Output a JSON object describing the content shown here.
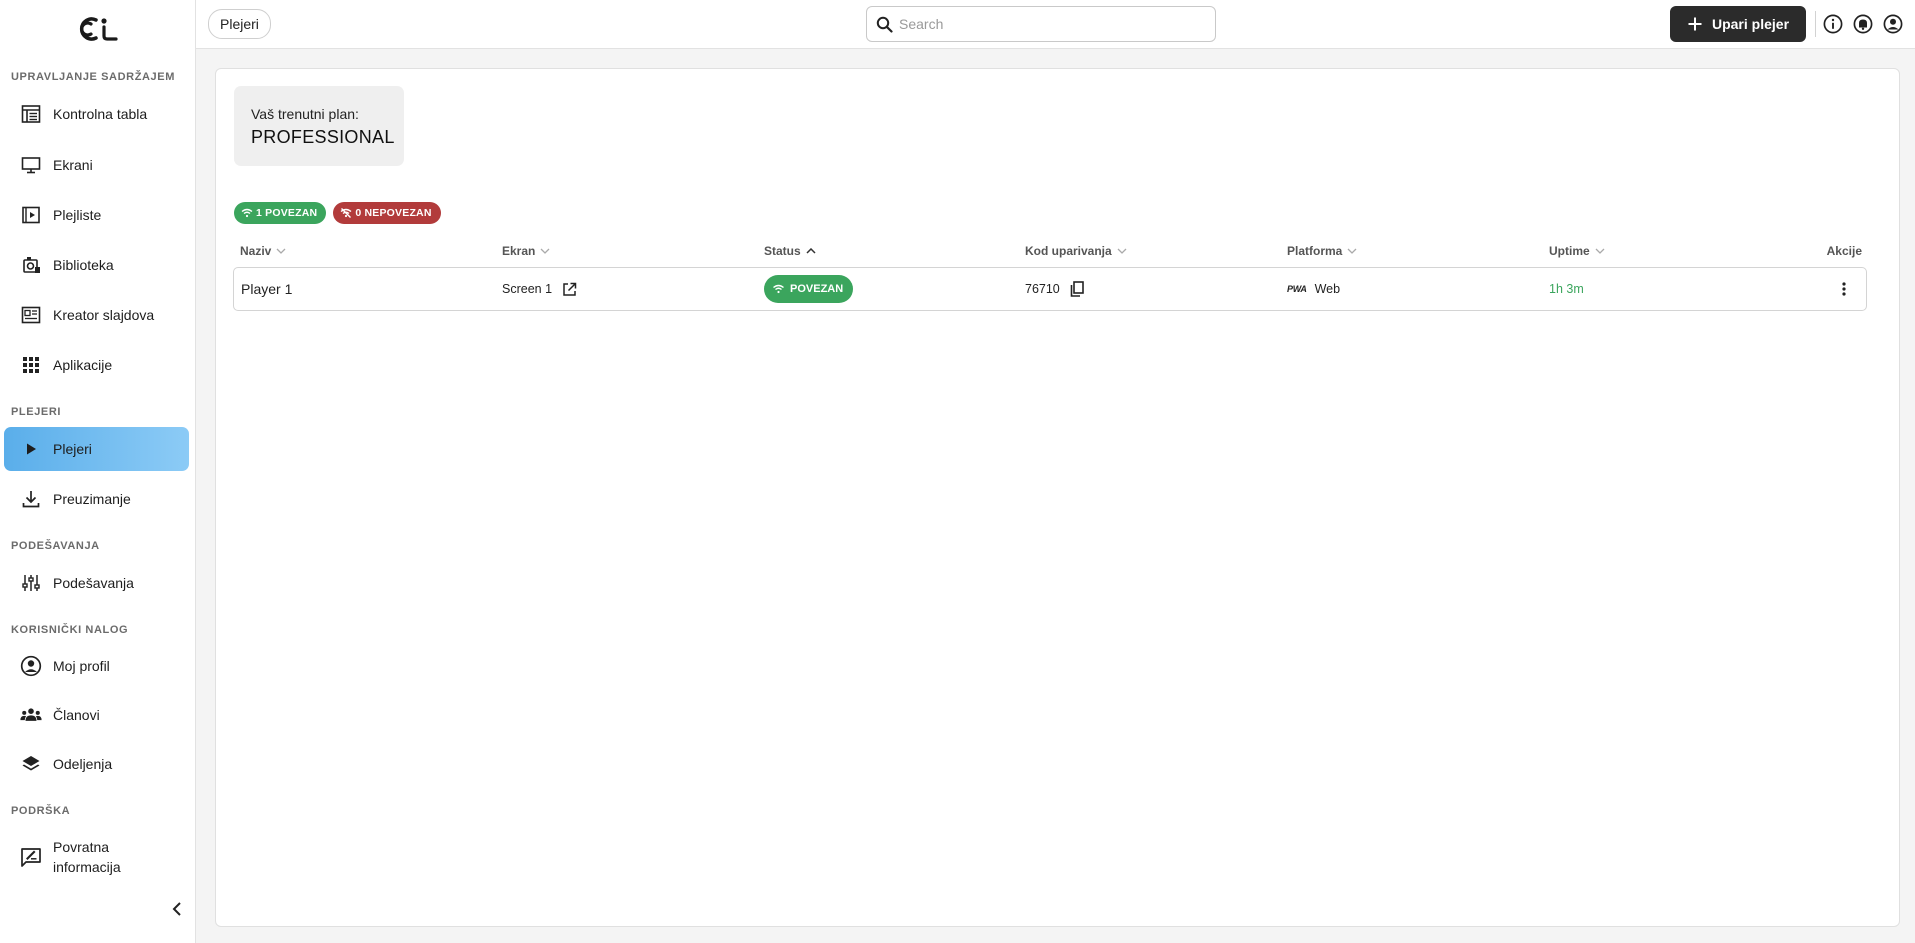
{
  "sidebar": {
    "sections": [
      {
        "title": "UPRAVLJANJE SADRŽAJEM"
      },
      {
        "title": "PLEJERI"
      },
      {
        "title": "PODEŠAVANJA"
      },
      {
        "title": "KORISNIČKI NALOG"
      },
      {
        "title": "PODRŠKA"
      }
    ],
    "items": [
      {
        "label": "Kontrolna tabla",
        "icon": "dashboard-icon"
      },
      {
        "label": "Ekrani",
        "icon": "monitor-icon"
      },
      {
        "label": "Plejliste",
        "icon": "playlist-icon"
      },
      {
        "label": "Biblioteka",
        "icon": "library-icon"
      },
      {
        "label": "Kreator slajdova",
        "icon": "slide-creator-icon"
      },
      {
        "label": "Aplikacije",
        "icon": "apps-grid-icon"
      },
      {
        "label": "Plejeri",
        "icon": "play-icon",
        "active": true
      },
      {
        "label": "Preuzimanje",
        "icon": "download-icon"
      },
      {
        "label": "Podešavanja",
        "icon": "sliders-icon"
      },
      {
        "label": "Moj profil",
        "icon": "account-circle-icon"
      },
      {
        "label": "Članovi",
        "icon": "members-icon"
      },
      {
        "label": "Odeljenja",
        "icon": "layers-icon"
      },
      {
        "label": "Povratna informacija",
        "icon": "feedback-icon"
      }
    ]
  },
  "topbar": {
    "breadcrumb": "Plejeri",
    "search_placeholder": "Search",
    "pair_button": "Upari plejer"
  },
  "plan": {
    "label": "Vaš trenutni plan:",
    "value": "PROFESSIONAL"
  },
  "badges": {
    "connected": "1 POVEZAN",
    "disconnected": "0 NEPOVEZAN"
  },
  "table": {
    "columns": [
      "Naziv",
      "Ekran",
      "Status",
      "Kod uparivanja",
      "Platforma",
      "Uptime",
      "Akcije"
    ],
    "rows": [
      {
        "name": "Player 1",
        "screen": "Screen 1",
        "status": "POVEZAN",
        "code": "76710",
        "platform_logo": "PWA",
        "platform": "Web",
        "uptime": "1h 3m"
      }
    ]
  },
  "colors": {
    "accent": "#5aaeea",
    "success": "#3ba55d",
    "danger": "#b23b3b",
    "dark_button": "#2b2b2b"
  }
}
